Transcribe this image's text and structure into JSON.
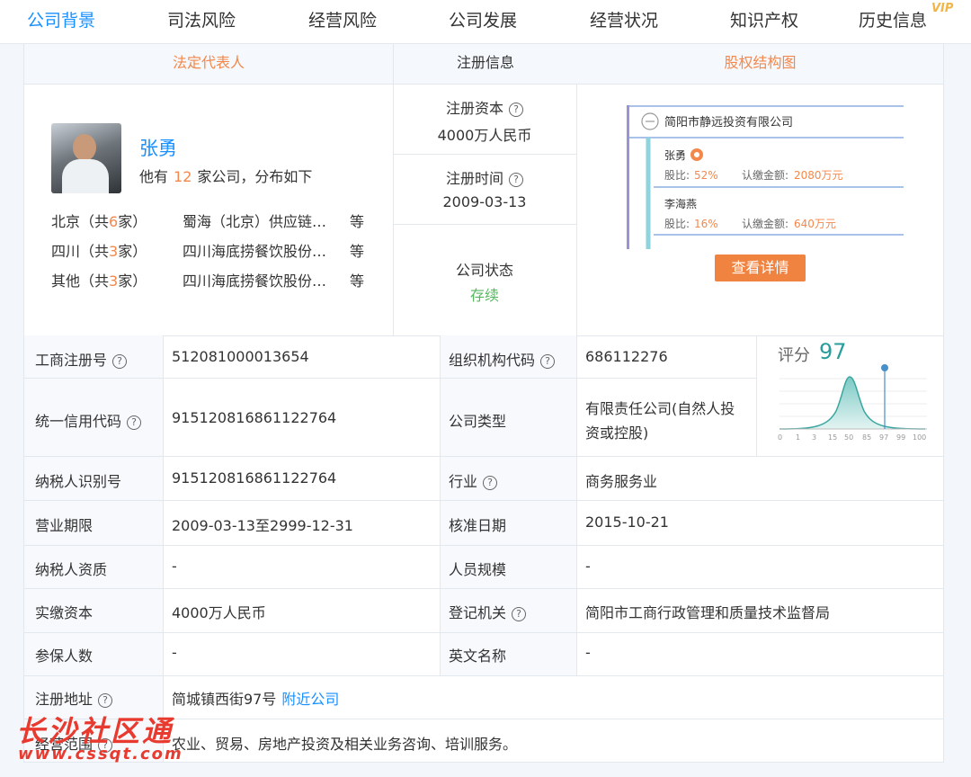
{
  "tabs": [
    "公司背景",
    "司法风险",
    "经营风险",
    "公司发展",
    "经营状况",
    "知识产权",
    "历史信息"
  ],
  "vip_label": "VIP",
  "section_heads": {
    "legal_rep": "法定代表人",
    "reg_info": "注册信息",
    "equity": "股权结构图"
  },
  "legal_rep": {
    "name": "张勇",
    "summary_prefix": "他有",
    "company_count": "12",
    "summary_suffix": "家公司，分布如下",
    "regions": [
      {
        "region_prefix": "北京（共",
        "count": "6",
        "region_suffix": "家）",
        "company": "蜀海（北京）供应链管理有限责任公司",
        "etc": "等"
      },
      {
        "region_prefix": "四川（共",
        "count": "3",
        "region_suffix": "家）",
        "company": "四川海底捞餐饮股份有限公司",
        "etc": "等"
      },
      {
        "region_prefix": "其他（共",
        "count": "3",
        "region_suffix": "家）",
        "company": "四川海底捞餐饮股份有限公司",
        "etc": "等"
      }
    ]
  },
  "registration": {
    "capital_label": "注册资本",
    "capital_value": "4000万人民币",
    "date_label": "注册时间",
    "date_value": "2009-03-13",
    "status_label": "公司状态",
    "status_value": "存续"
  },
  "equity": {
    "company": "简阳市静远投资有限公司",
    "holders": [
      {
        "name": "张勇",
        "ratio_label": "股比:",
        "ratio": "52%",
        "sub_label": "认缴金额:",
        "sub_amount": "2080万元"
      },
      {
        "name": "李海燕",
        "ratio_label": "股比:",
        "ratio": "16%",
        "sub_label": "认缴金额:",
        "sub_amount": "640万元"
      }
    ],
    "details_button": "查看详情"
  },
  "fields": {
    "biz_reg_no": {
      "label": "工商注册号",
      "value": "512081000013654"
    },
    "org_code": {
      "label": "组织机构代码",
      "value": "686112276"
    },
    "credit_code": {
      "label": "统一信用代码",
      "value": "915120816861122764"
    },
    "company_type": {
      "label": "公司类型",
      "value_line1": "有限责任公司(自然人投",
      "value_line2": "资或控股)"
    },
    "taxpayer_id": {
      "label": "纳税人识别号",
      "value": "915120816861122764"
    },
    "industry": {
      "label": "行业",
      "value": "商务服务业"
    },
    "term": {
      "label": "营业期限",
      "value": "2009-03-13至2999-12-31"
    },
    "approval_date": {
      "label": "核准日期",
      "value": "2015-10-21"
    },
    "taxpayer_qual": {
      "label": "纳税人资质",
      "value": "-"
    },
    "staff_size": {
      "label": "人员规模",
      "value": "-"
    },
    "paid_capital": {
      "label": "实缴资本",
      "value": "4000万人民币"
    },
    "reg_authority": {
      "label": "登记机关",
      "value": "简阳市工商行政管理和质量技术监督局"
    },
    "insured": {
      "label": "参保人数",
      "value": "-"
    },
    "english_name": {
      "label": "英文名称",
      "value": "-"
    },
    "address": {
      "label": "注册地址",
      "value": "简城镇西街97号",
      "link": "附近公司"
    },
    "scope": {
      "label": "经营范围",
      "value": "农业、贸易、房地产投资及相关业务咨询、培训服务。"
    }
  },
  "score": {
    "label": "评分",
    "value": "97",
    "axis": [
      "0",
      "1",
      "3",
      "15",
      "50",
      "85",
      "97",
      "99",
      "100"
    ]
  },
  "watermark": {
    "line1": "长沙社区通",
    "line2": "www.cssqt.com"
  },
  "colors": {
    "accent": "#1890ff",
    "orange": "#f4884b",
    "green": "#57b75f",
    "teal": "#2a9d9a"
  }
}
